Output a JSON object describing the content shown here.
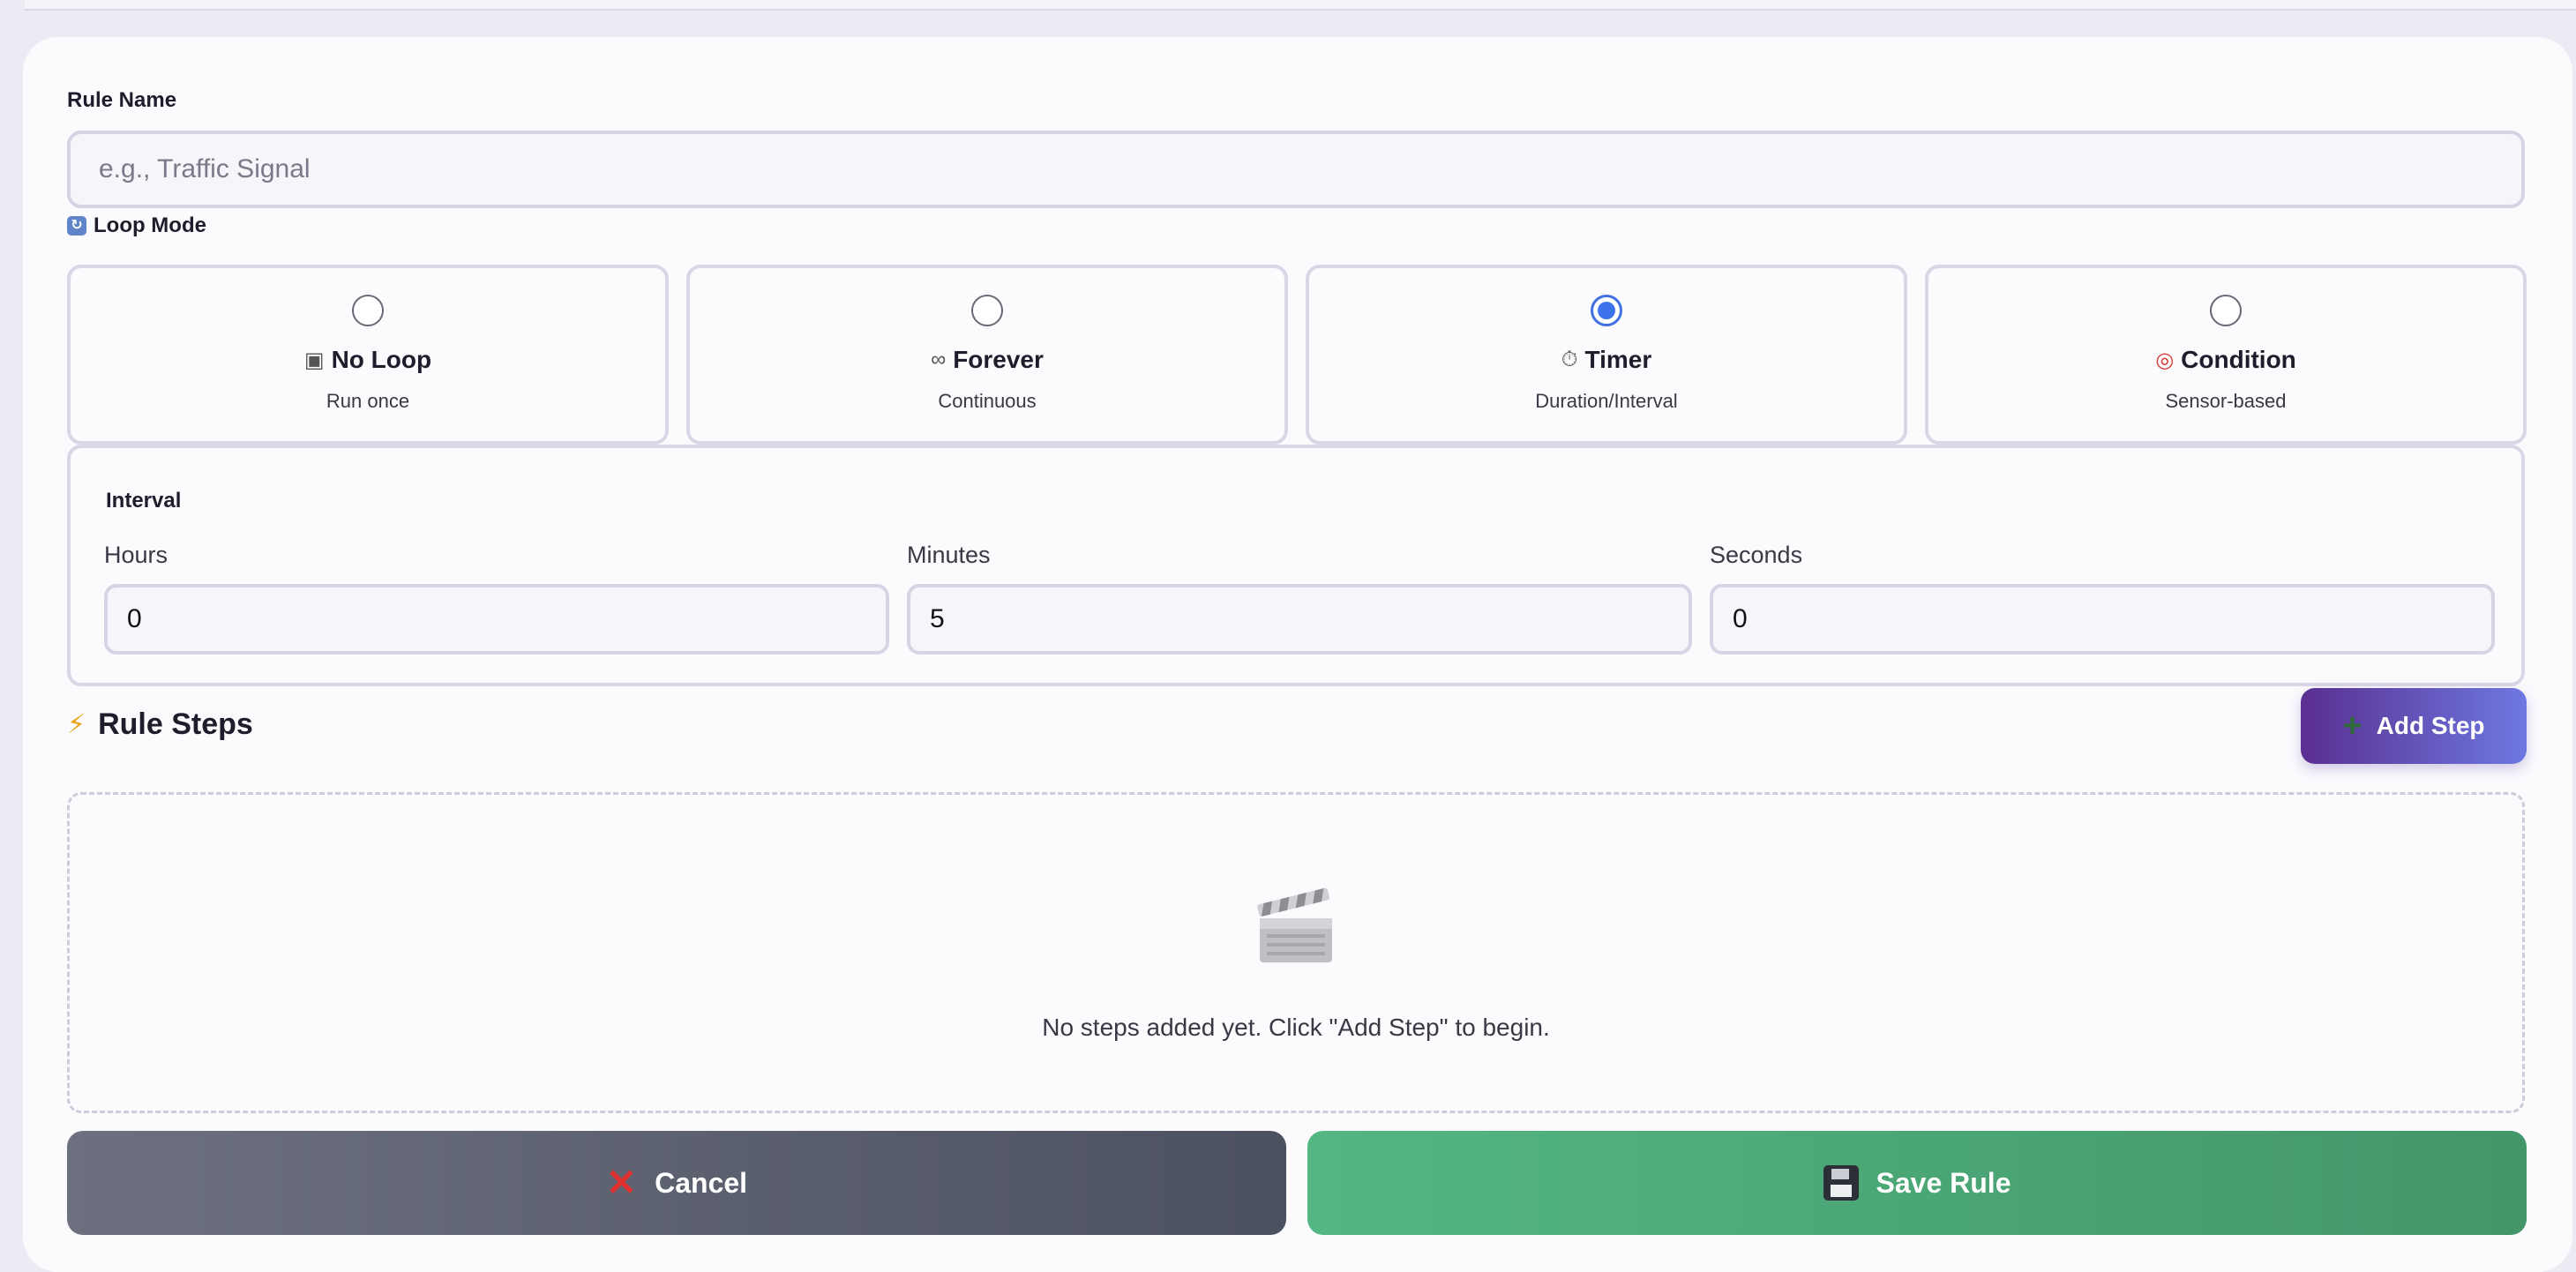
{
  "form": {
    "rule_name_label": "Rule Name",
    "rule_name_placeholder": "e.g., Traffic Signal",
    "rule_name_value": "",
    "loop_mode_label": "Loop Mode"
  },
  "loop_modes": [
    {
      "title": "No Loop",
      "subtitle": "Run once",
      "icon": "stop-square-icon",
      "selected": false
    },
    {
      "title": "Forever",
      "subtitle": "Continuous",
      "icon": "infinity-icon",
      "selected": false
    },
    {
      "title": "Timer",
      "subtitle": "Duration/Interval",
      "icon": "stopwatch-icon",
      "selected": true
    },
    {
      "title": "Condition",
      "subtitle": "Sensor-based",
      "icon": "target-icon",
      "selected": false
    }
  ],
  "interval": {
    "title": "Interval",
    "hours_label": "Hours",
    "hours_value": "0",
    "minutes_label": "Minutes",
    "minutes_value": "5",
    "seconds_label": "Seconds",
    "seconds_value": "0"
  },
  "steps": {
    "title": "Rule Steps",
    "add_label": "Add Step",
    "empty_text": "No steps added yet. Click \"Add Step\" to begin."
  },
  "actions": {
    "cancel_label": "Cancel",
    "save_label": "Save Rule"
  },
  "colors": {
    "accent_blue": "#3d73ea",
    "add_step_gradient_start": "#5a2f91",
    "add_step_gradient_end": "#6d78e0",
    "cancel_bg": "#5d6270",
    "save_bg": "#4ca776"
  }
}
